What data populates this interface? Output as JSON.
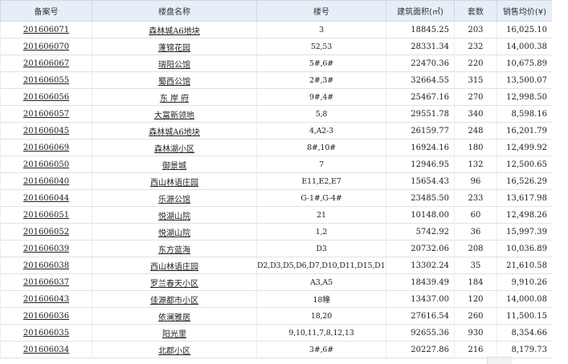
{
  "table": {
    "headers": [
      "备案号",
      "楼盘名称",
      "楼号",
      "建筑面积(㎡)",
      "套数",
      "销售均价(¥)"
    ],
    "rows": [
      [
        "201606071",
        "森林城A6地块",
        "3",
        "18845.25",
        "203",
        "16,025.10"
      ],
      [
        "201606070",
        "蓬锦花园",
        "52,53",
        "28331.34",
        "232",
        "14,000.38"
      ],
      [
        "201606067",
        "瑞阳公馆",
        "5#,6#",
        "22470.36",
        "220",
        "10,675.89"
      ],
      [
        "201606055",
        "蜀西公馆",
        "2#,3#",
        "32664.55",
        "315",
        "13,500.07"
      ],
      [
        "201606056",
        "东 岸 府",
        "9#,4#",
        "25467.16",
        "270",
        "12,998.50"
      ],
      [
        "201606057",
        "大富新领地",
        "5,8",
        "29551.78",
        "340",
        "8,598.16"
      ],
      [
        "201606045",
        "森林城A6地块",
        "4,A2-3",
        "26159.77",
        "248",
        "16,201.79"
      ],
      [
        "201606069",
        "森林湖小区",
        "8#,10#",
        "16924.16",
        "180",
        "12,499.92"
      ],
      [
        "201606050",
        "御景城",
        "7",
        "12946.95",
        "132",
        "12,500.65"
      ],
      [
        "201606040",
        "西山林语庄园",
        "E11,E2,E7",
        "15654.43",
        "96",
        "16,526.29"
      ],
      [
        "201606044",
        "乐源公馆",
        "G-1#,G-4#",
        "23485.50",
        "233",
        "13,617.98"
      ],
      [
        "201606051",
        "悦湖山院",
        "21",
        "10148.00",
        "60",
        "12,498.26"
      ],
      [
        "201606052",
        "悦湖山院",
        "1,2",
        "5742.92",
        "36",
        "15,997.39"
      ],
      [
        "201606039",
        "东方蓝海",
        "D3",
        "20732.06",
        "208",
        "10,036.89"
      ],
      [
        "201606038",
        "西山林语庄园",
        "D2,D3,D5,D6,D7,D10,D11,D15,D16",
        "13302.24",
        "35",
        "21,610.58"
      ],
      [
        "201606037",
        "罗兰春天小区",
        "A3,A5",
        "18439.49",
        "184",
        "9,910.26"
      ],
      [
        "201606043",
        "佳源都市小区",
        "18幢",
        "13437.00",
        "120",
        "14,000.08"
      ],
      [
        "201606036",
        "依澜雅居",
        "18,20",
        "27616.54",
        "260",
        "11,500.15"
      ],
      [
        "201606035",
        "阳光里",
        "9,10,11,7,8,12,13",
        "92655.36",
        "930",
        "8,354.66"
      ],
      [
        "201606034",
        "北郡小区",
        "3#,6#",
        "20227.86",
        "216",
        "8,179.73"
      ]
    ]
  }
}
